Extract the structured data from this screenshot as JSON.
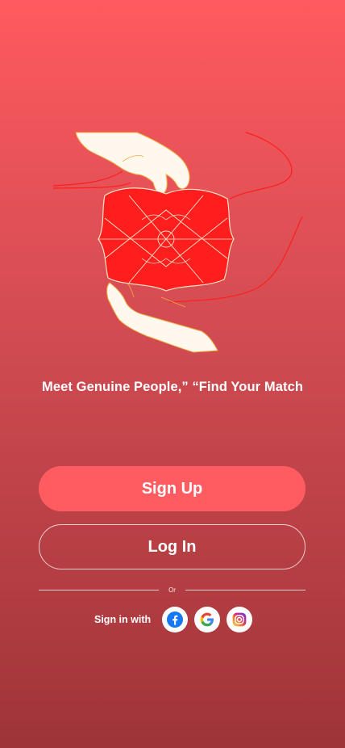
{
  "hero": {
    "illustration_icon": "hands-holding-heart-pattern-icon"
  },
  "tagline": "Meet Genuine People,” “Find Your Match",
  "buttons": {
    "signup_label": "Sign Up",
    "login_label": "Log In"
  },
  "divider": {
    "label": "Or"
  },
  "social": {
    "label": "Sign in with",
    "providers": [
      {
        "name": "facebook-icon"
      },
      {
        "name": "google-icon"
      },
      {
        "name": "instagram-icon"
      }
    ]
  },
  "colors": {
    "gradient_top": "#FF5A5F",
    "gradient_bottom": "#9E3438",
    "primary_button": "#FF5C62",
    "pattern_red": "#FF1E1E"
  }
}
